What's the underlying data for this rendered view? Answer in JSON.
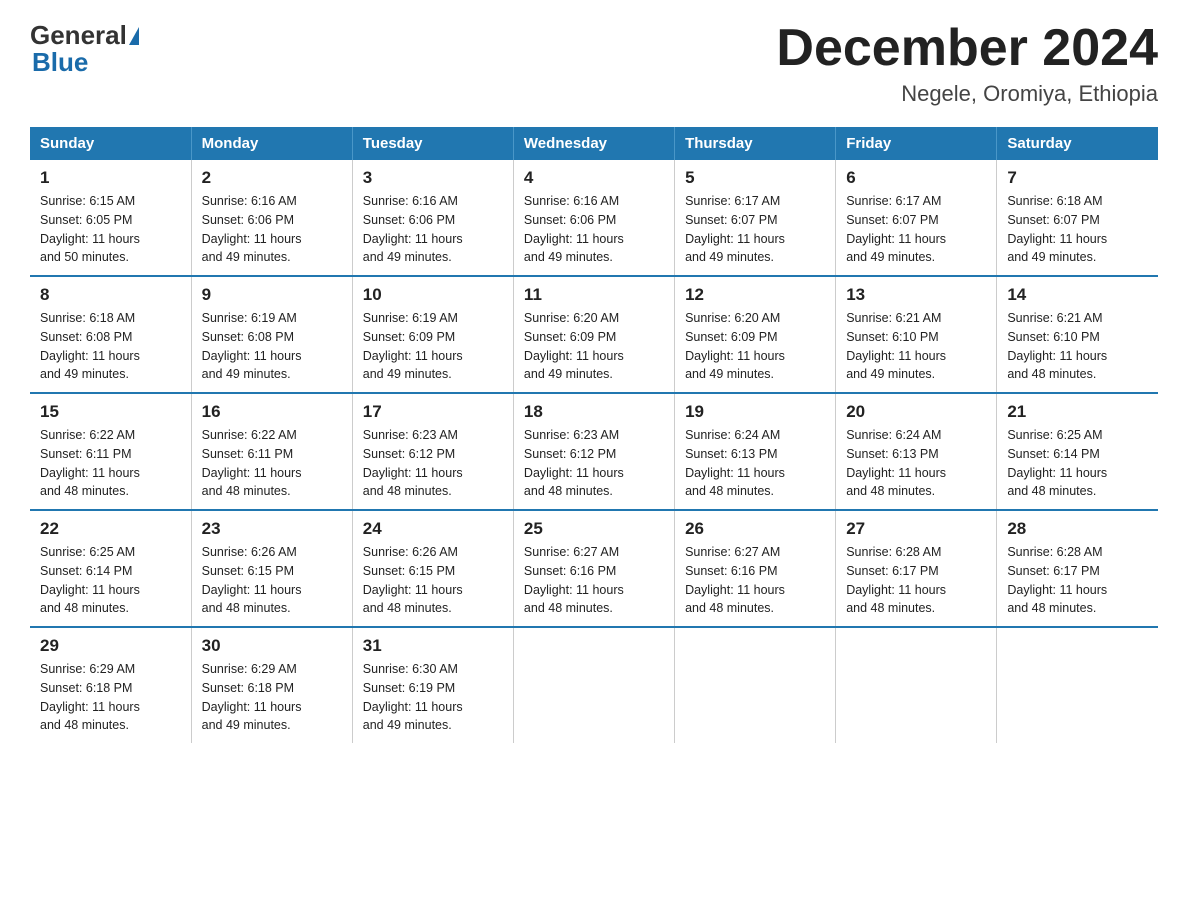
{
  "logo": {
    "general": "General",
    "blue": "Blue"
  },
  "title": {
    "month": "December 2024",
    "location": "Negele, Oromiya, Ethiopia"
  },
  "headers": [
    "Sunday",
    "Monday",
    "Tuesday",
    "Wednesday",
    "Thursday",
    "Friday",
    "Saturday"
  ],
  "weeks": [
    [
      {
        "day": "1",
        "info": "Sunrise: 6:15 AM\nSunset: 6:05 PM\nDaylight: 11 hours\nand 50 minutes."
      },
      {
        "day": "2",
        "info": "Sunrise: 6:16 AM\nSunset: 6:06 PM\nDaylight: 11 hours\nand 49 minutes."
      },
      {
        "day": "3",
        "info": "Sunrise: 6:16 AM\nSunset: 6:06 PM\nDaylight: 11 hours\nand 49 minutes."
      },
      {
        "day": "4",
        "info": "Sunrise: 6:16 AM\nSunset: 6:06 PM\nDaylight: 11 hours\nand 49 minutes."
      },
      {
        "day": "5",
        "info": "Sunrise: 6:17 AM\nSunset: 6:07 PM\nDaylight: 11 hours\nand 49 minutes."
      },
      {
        "day": "6",
        "info": "Sunrise: 6:17 AM\nSunset: 6:07 PM\nDaylight: 11 hours\nand 49 minutes."
      },
      {
        "day": "7",
        "info": "Sunrise: 6:18 AM\nSunset: 6:07 PM\nDaylight: 11 hours\nand 49 minutes."
      }
    ],
    [
      {
        "day": "8",
        "info": "Sunrise: 6:18 AM\nSunset: 6:08 PM\nDaylight: 11 hours\nand 49 minutes."
      },
      {
        "day": "9",
        "info": "Sunrise: 6:19 AM\nSunset: 6:08 PM\nDaylight: 11 hours\nand 49 minutes."
      },
      {
        "day": "10",
        "info": "Sunrise: 6:19 AM\nSunset: 6:09 PM\nDaylight: 11 hours\nand 49 minutes."
      },
      {
        "day": "11",
        "info": "Sunrise: 6:20 AM\nSunset: 6:09 PM\nDaylight: 11 hours\nand 49 minutes."
      },
      {
        "day": "12",
        "info": "Sunrise: 6:20 AM\nSunset: 6:09 PM\nDaylight: 11 hours\nand 49 minutes."
      },
      {
        "day": "13",
        "info": "Sunrise: 6:21 AM\nSunset: 6:10 PM\nDaylight: 11 hours\nand 49 minutes."
      },
      {
        "day": "14",
        "info": "Sunrise: 6:21 AM\nSunset: 6:10 PM\nDaylight: 11 hours\nand 48 minutes."
      }
    ],
    [
      {
        "day": "15",
        "info": "Sunrise: 6:22 AM\nSunset: 6:11 PM\nDaylight: 11 hours\nand 48 minutes."
      },
      {
        "day": "16",
        "info": "Sunrise: 6:22 AM\nSunset: 6:11 PM\nDaylight: 11 hours\nand 48 minutes."
      },
      {
        "day": "17",
        "info": "Sunrise: 6:23 AM\nSunset: 6:12 PM\nDaylight: 11 hours\nand 48 minutes."
      },
      {
        "day": "18",
        "info": "Sunrise: 6:23 AM\nSunset: 6:12 PM\nDaylight: 11 hours\nand 48 minutes."
      },
      {
        "day": "19",
        "info": "Sunrise: 6:24 AM\nSunset: 6:13 PM\nDaylight: 11 hours\nand 48 minutes."
      },
      {
        "day": "20",
        "info": "Sunrise: 6:24 AM\nSunset: 6:13 PM\nDaylight: 11 hours\nand 48 minutes."
      },
      {
        "day": "21",
        "info": "Sunrise: 6:25 AM\nSunset: 6:14 PM\nDaylight: 11 hours\nand 48 minutes."
      }
    ],
    [
      {
        "day": "22",
        "info": "Sunrise: 6:25 AM\nSunset: 6:14 PM\nDaylight: 11 hours\nand 48 minutes."
      },
      {
        "day": "23",
        "info": "Sunrise: 6:26 AM\nSunset: 6:15 PM\nDaylight: 11 hours\nand 48 minutes."
      },
      {
        "day": "24",
        "info": "Sunrise: 6:26 AM\nSunset: 6:15 PM\nDaylight: 11 hours\nand 48 minutes."
      },
      {
        "day": "25",
        "info": "Sunrise: 6:27 AM\nSunset: 6:16 PM\nDaylight: 11 hours\nand 48 minutes."
      },
      {
        "day": "26",
        "info": "Sunrise: 6:27 AM\nSunset: 6:16 PM\nDaylight: 11 hours\nand 48 minutes."
      },
      {
        "day": "27",
        "info": "Sunrise: 6:28 AM\nSunset: 6:17 PM\nDaylight: 11 hours\nand 48 minutes."
      },
      {
        "day": "28",
        "info": "Sunrise: 6:28 AM\nSunset: 6:17 PM\nDaylight: 11 hours\nand 48 minutes."
      }
    ],
    [
      {
        "day": "29",
        "info": "Sunrise: 6:29 AM\nSunset: 6:18 PM\nDaylight: 11 hours\nand 48 minutes."
      },
      {
        "day": "30",
        "info": "Sunrise: 6:29 AM\nSunset: 6:18 PM\nDaylight: 11 hours\nand 49 minutes."
      },
      {
        "day": "31",
        "info": "Sunrise: 6:30 AM\nSunset: 6:19 PM\nDaylight: 11 hours\nand 49 minutes."
      },
      {
        "day": "",
        "info": ""
      },
      {
        "day": "",
        "info": ""
      },
      {
        "day": "",
        "info": ""
      },
      {
        "day": "",
        "info": ""
      }
    ]
  ]
}
